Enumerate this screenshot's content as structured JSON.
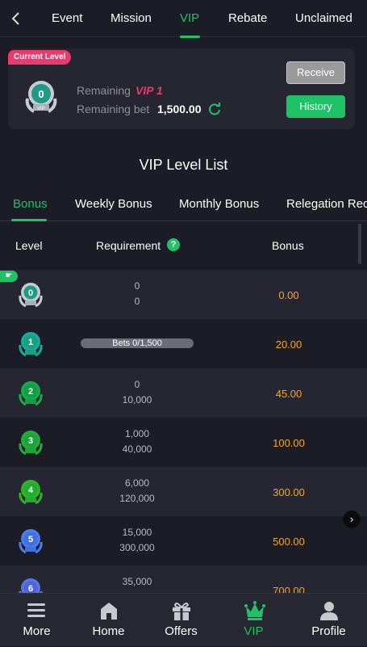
{
  "top_nav": {
    "back_icon": "chevron-left-icon",
    "tabs": [
      {
        "label": "Event",
        "active": false
      },
      {
        "label": "Mission",
        "active": false
      },
      {
        "label": "VIP",
        "active": true
      },
      {
        "label": "Rebate",
        "active": false
      },
      {
        "label": "Unclaimed",
        "active": false
      }
    ]
  },
  "current_level_card": {
    "badge": "Current Level",
    "level": "0",
    "medal_text": "VIP",
    "remaining_label": "Remaining",
    "remaining_value": "VIP 1",
    "remaining_bet_label": "Remaining bet",
    "remaining_bet_value": "1,500.00",
    "receive_label": "Receive",
    "history_label": "History"
  },
  "section_title": "VIP Level List",
  "sub_tabs": [
    {
      "label": "Bonus",
      "active": true
    },
    {
      "label": "Weekly Bonus",
      "active": false
    },
    {
      "label": "Monthly Bonus",
      "active": false
    },
    {
      "label": "Relegation Rec",
      "active": false
    }
  ],
  "table": {
    "headers": {
      "level": "Level",
      "requirement": "Requirement",
      "help": "?",
      "bonus": "Bonus"
    },
    "rows": [
      {
        "level": "0",
        "req_top": "0",
        "req_bottom": "0",
        "bonus": "0.00",
        "current": true
      },
      {
        "level": "1",
        "progress": "Bets 0/1,500",
        "progress_fraction": 0,
        "bonus": "20.00"
      },
      {
        "level": "2",
        "req_top": "0",
        "req_bottom": "10,000",
        "bonus": "45.00"
      },
      {
        "level": "3",
        "req_top": "1,000",
        "req_bottom": "40,000",
        "bonus": "100.00"
      },
      {
        "level": "4",
        "req_top": "6,000",
        "req_bottom": "120,000",
        "bonus": "300.00"
      },
      {
        "level": "5",
        "req_top": "15,000",
        "req_bottom": "300,000",
        "bonus": "500.00"
      },
      {
        "level": "6",
        "req_top": "35,000",
        "req_bottom": "",
        "bonus": "700.00"
      }
    ]
  },
  "bottom_nav": [
    {
      "label": "More",
      "icon": "menu-icon",
      "active": false
    },
    {
      "label": "Home",
      "icon": "home-icon",
      "active": false
    },
    {
      "label": "Offers",
      "icon": "gift-icon",
      "active": false
    },
    {
      "label": "VIP",
      "icon": "crown-icon",
      "active": true
    },
    {
      "label": "Profile",
      "icon": "user-icon",
      "active": false
    }
  ],
  "colors": {
    "accent": "#1fc266",
    "background": "#1b1c25",
    "card": "#252632",
    "bonus": "#f6a623",
    "badge": "#ea3b6a"
  }
}
